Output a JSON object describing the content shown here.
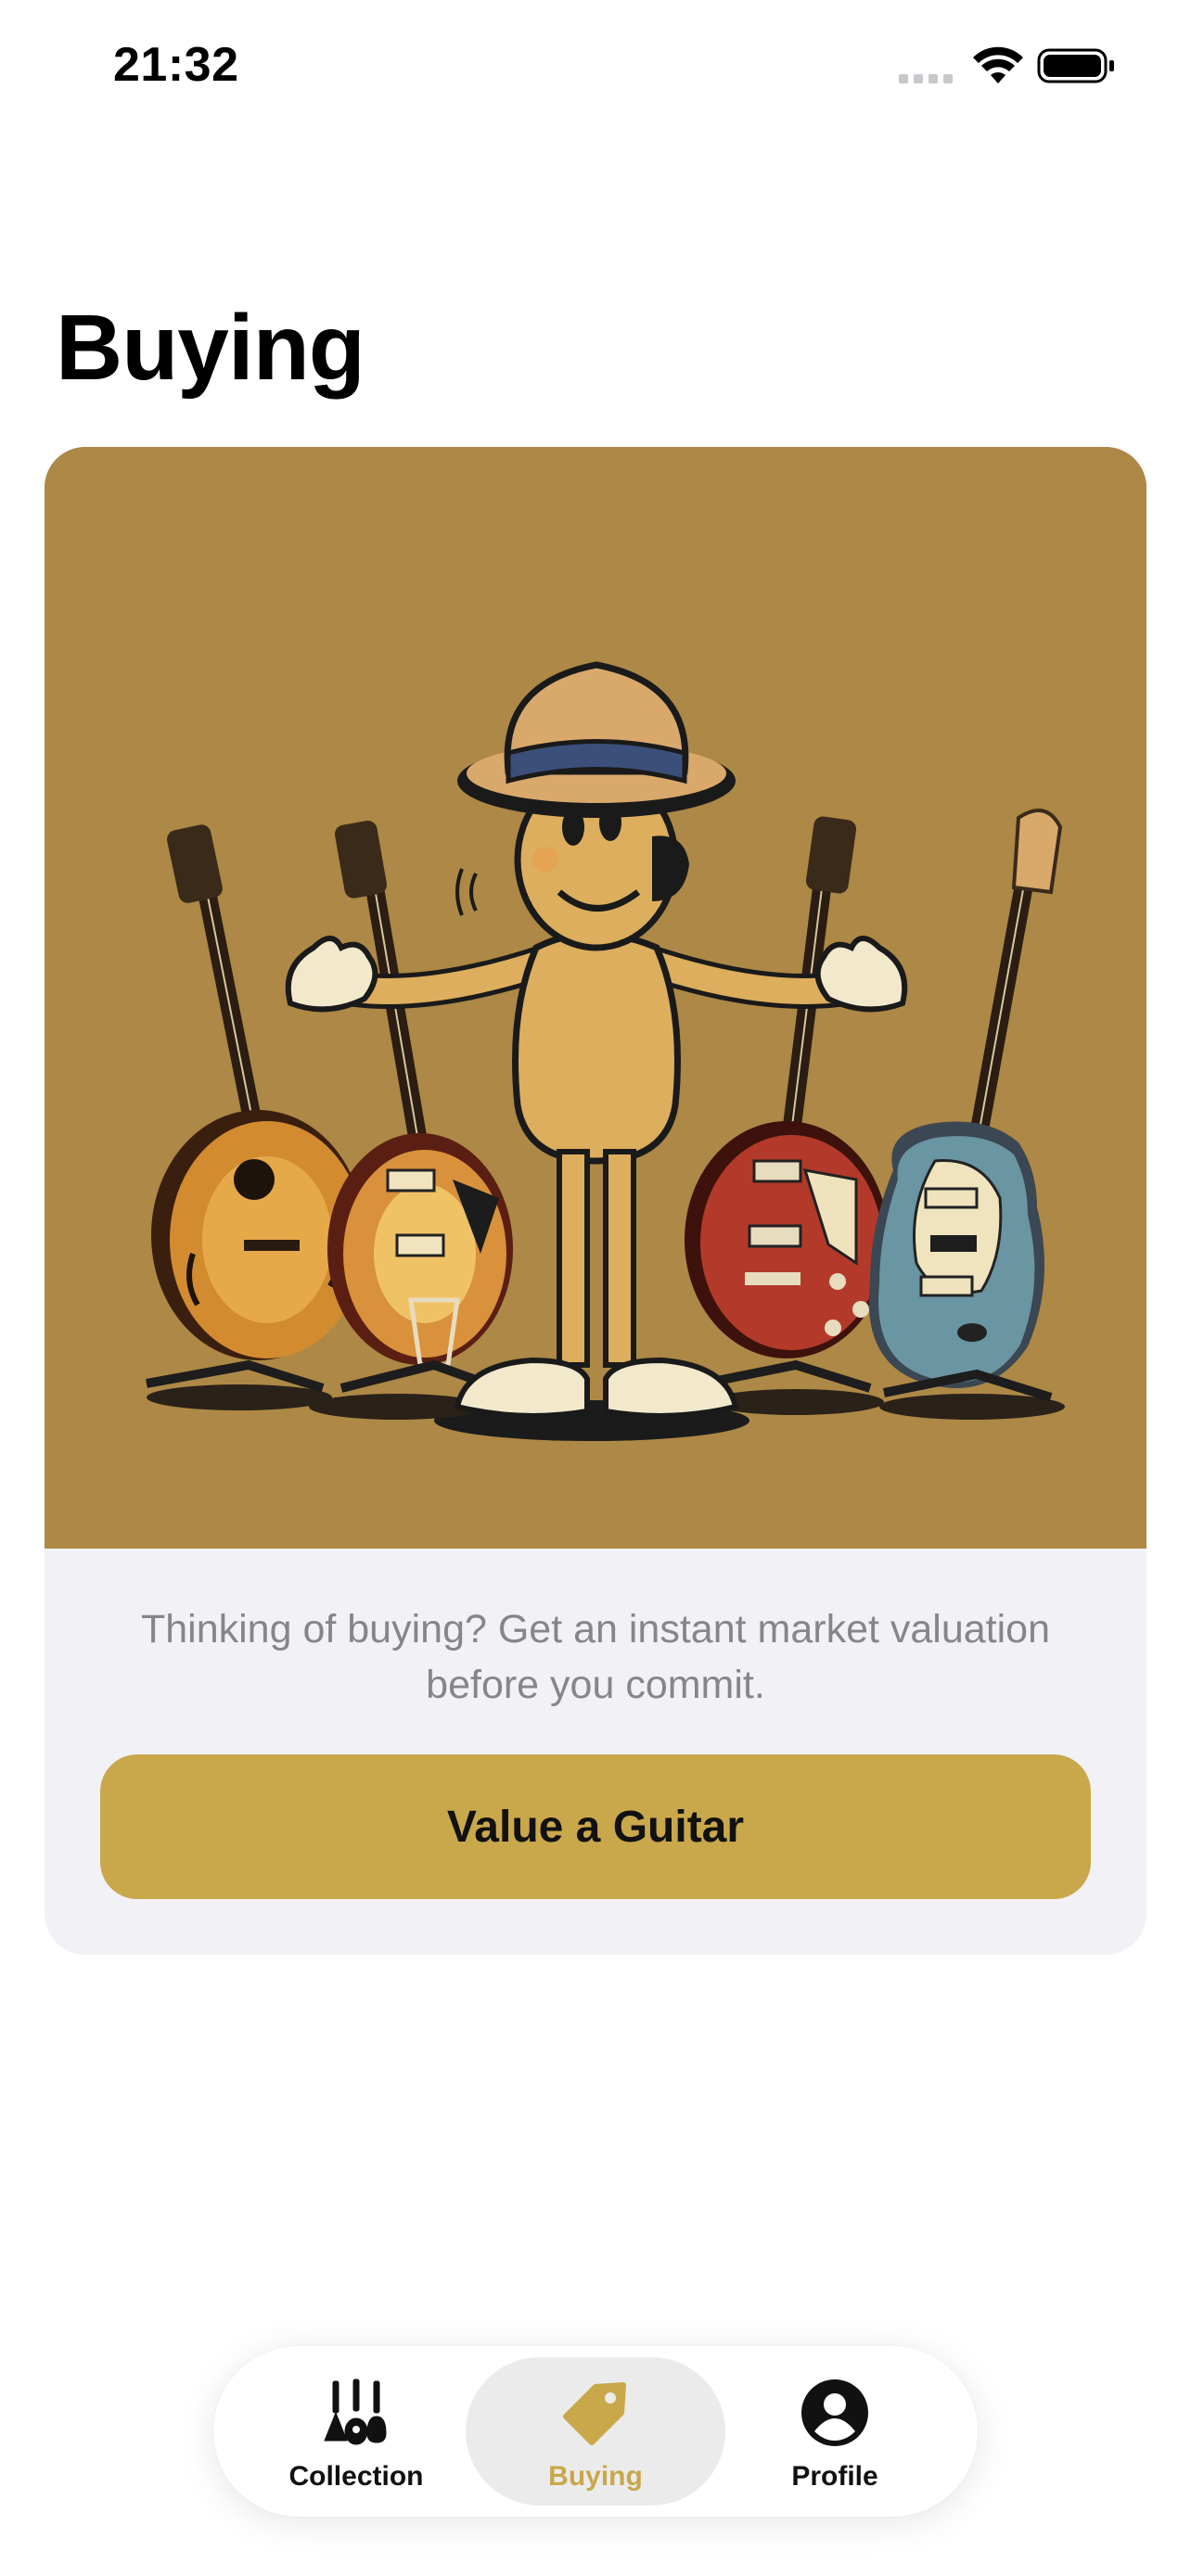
{
  "status_bar": {
    "time": "21:32"
  },
  "page": {
    "title": "Buying"
  },
  "card": {
    "illustration": "cartoon salesman with hat presenting four guitars on stands",
    "description": "Thinking of buying? Get an instant market valuation before you commit.",
    "button_label": "Value a Guitar"
  },
  "tab_bar": {
    "tabs": [
      {
        "label": "Collection",
        "icon": "guitars-icon",
        "active": false
      },
      {
        "label": "Buying",
        "icon": "price-tag-icon",
        "active": true
      },
      {
        "label": "Profile",
        "icon": "person-circle-icon",
        "active": false
      }
    ]
  },
  "colors": {
    "accent": "#c9a74b",
    "hero_background": "#ad8846",
    "card_background": "#f2f1f6",
    "secondary_text": "#85858b"
  }
}
